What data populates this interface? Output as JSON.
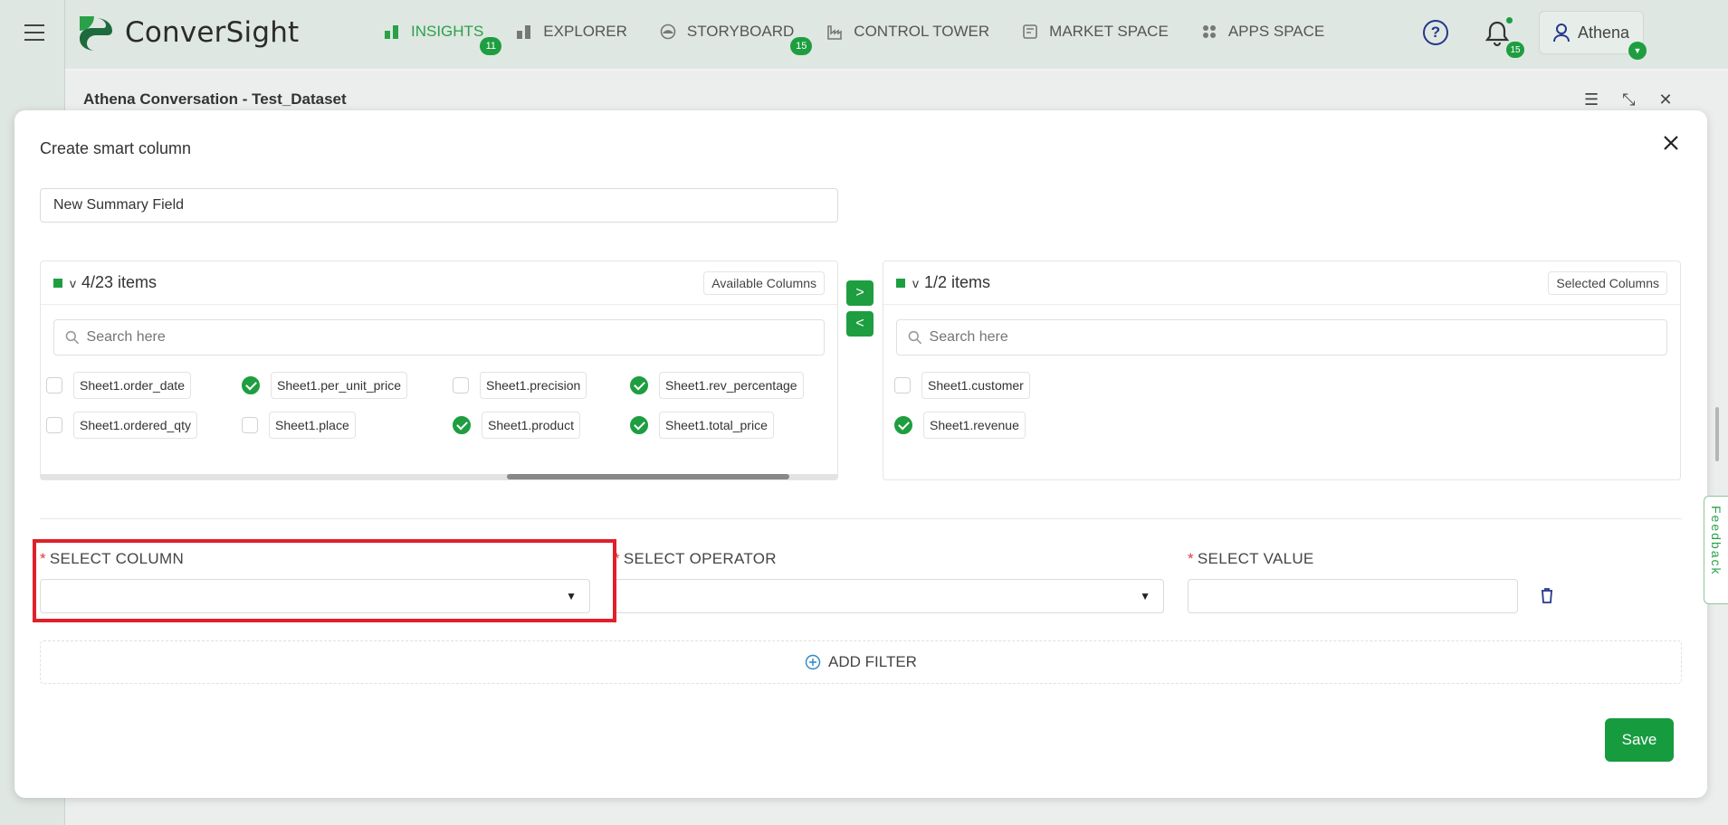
{
  "app": {
    "brand": "ConverSight"
  },
  "nav": {
    "items": [
      {
        "label": "INSIGHTS",
        "icon": "bar-chart-icon",
        "badge": "11",
        "active": true
      },
      {
        "label": "EXPLORER",
        "icon": "bar-chart-icon",
        "badge": "",
        "active": false
      },
      {
        "label": "STORYBOARD",
        "icon": "palette-icon",
        "badge": "15",
        "active": false
      },
      {
        "label": "CONTROL TOWER",
        "icon": "factory-icon",
        "badge": "",
        "active": false
      },
      {
        "label": "MARKET SPACE",
        "icon": "store-icon",
        "badge": "",
        "active": false
      },
      {
        "label": "APPS SPACE",
        "icon": "grid-icon",
        "badge": "",
        "active": false
      }
    ],
    "help_glyph": "?",
    "notification_count": "15",
    "user_name": "Athena"
  },
  "background": {
    "title": "Athena Conversation - Test_Dataset"
  },
  "modal": {
    "title": "Create smart column",
    "name_value": "New Summary Field",
    "available": {
      "count_label": "4/23 items",
      "tag": "Available Columns",
      "search_placeholder": "Search here",
      "items": [
        {
          "label": "Sheet1.order_date",
          "checked": false
        },
        {
          "label": "Sheet1.per_unit_price",
          "checked": true
        },
        {
          "label": "Sheet1.precision",
          "checked": false
        },
        {
          "label": "Sheet1.rev_percentage",
          "checked": true
        },
        {
          "label": "Sheet1.ordered_qty",
          "checked": false
        },
        {
          "label": "Sheet1.place",
          "checked": false
        },
        {
          "label": "Sheet1.product",
          "checked": true
        },
        {
          "label": "Sheet1.total_price",
          "checked": true
        }
      ]
    },
    "selected": {
      "count_label": "1/2 items",
      "tag": "Selected Columns",
      "search_placeholder": "Search here",
      "items": [
        {
          "label": "Sheet1.customer",
          "checked": false
        },
        {
          "label": "Sheet1.revenue",
          "checked": true
        }
      ]
    },
    "transfer": {
      "right": ">",
      "left": "<"
    },
    "filters": {
      "required_mark": "*",
      "column_label": "SELECT COLUMN",
      "operator_label": "SELECT OPERATOR",
      "value_label": "SELECT VALUE",
      "column_value": "",
      "operator_value": "",
      "value_value": "",
      "add_filter_label": "ADD FILTER"
    },
    "save_label": "Save"
  },
  "feedback_label": "Feedback",
  "colors": {
    "accent": "#1e9e40",
    "highlight": "#e0202a",
    "required": "#e23b3b"
  }
}
